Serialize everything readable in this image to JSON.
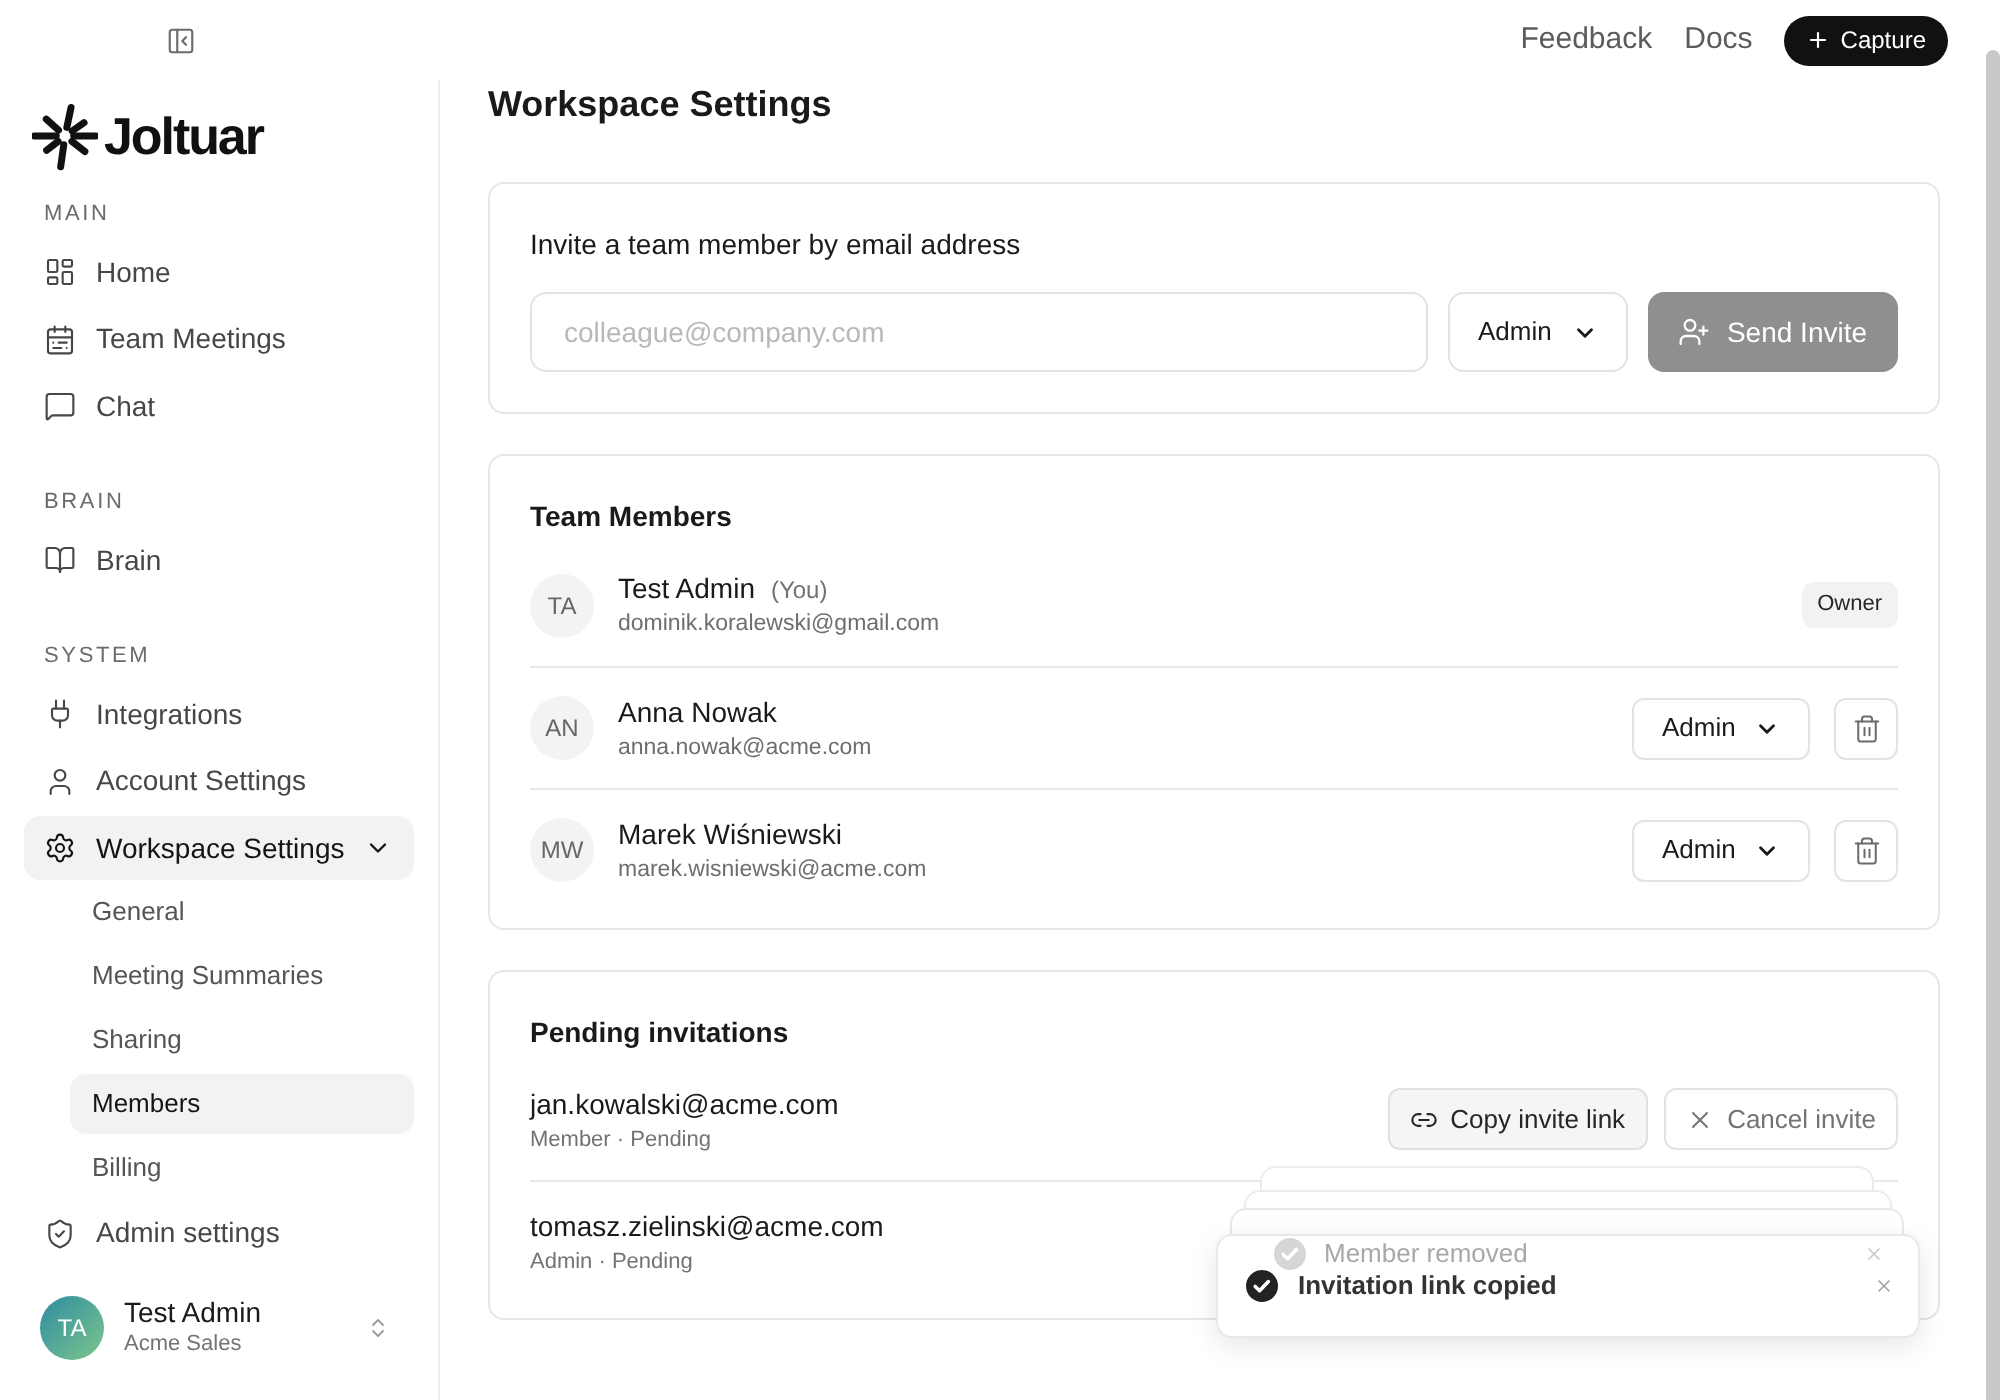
{
  "sidebar": {
    "logo": {
      "wordmark": "Joltuar"
    },
    "sections": [
      {
        "label": "MAIN",
        "items": [
          {
            "label": "Home",
            "selected": false
          },
          {
            "label": "Team Meetings",
            "selected": false
          },
          {
            "label": "Chat",
            "selected": false
          }
        ]
      },
      {
        "label": "BRAIN",
        "items": [
          {
            "label": "Brain",
            "selected": false
          }
        ]
      },
      {
        "label": "SYSTEM",
        "items": [
          {
            "label": "Integrations",
            "selected": false
          },
          {
            "label": "Account Settings",
            "selected": false
          },
          {
            "label": "Workspace Settings",
            "selected": true,
            "expanded": true,
            "children": [
              {
                "label": "General",
                "selected": false
              },
              {
                "label": "Meeting Summaries",
                "selected": false
              },
              {
                "label": "Sharing",
                "selected": false
              },
              {
                "label": "Members",
                "selected": true
              },
              {
                "label": "Billing",
                "selected": false
              }
            ]
          },
          {
            "label": "Admin settings",
            "selected": false
          }
        ]
      }
    ],
    "user": {
      "initials": "TA",
      "name": "Test Admin",
      "workspace": "Acme Sales"
    }
  },
  "top_bar": {
    "links": [
      "Feedback",
      "Docs"
    ],
    "capture_button": "Capture"
  },
  "page": {
    "title": "Workspace Settings"
  },
  "invite": {
    "label": "Invite a team member by email address",
    "email": {
      "placeholder": "colleague@company.com"
    },
    "role": "Admin",
    "button": {
      "label": "Send Invite",
      "disabled": true
    }
  },
  "team_members": {
    "title": "Team Members",
    "members": [
      {
        "initials": "TA",
        "name": "Test Admin",
        "you_tag": "(You)",
        "email": "dominik.koralewski@gmail.com",
        "badge": "Owner"
      },
      {
        "initials": "AN",
        "name": "Anna Nowak",
        "email": "anna.nowak@acme.com",
        "role": "Admin"
      },
      {
        "initials": "MW",
        "name": "Marek Wiśniewski",
        "email": "marek.wisniewski@acme.com",
        "role": "Admin"
      }
    ]
  },
  "pending_invitations": {
    "title": "Pending invitations",
    "invites": [
      {
        "email": "jan.kowalski@acme.com",
        "details": "Member · Pending",
        "actions": [
          {
            "kind": "copy",
            "label": "Copy invite link"
          },
          {
            "kind": "cancel",
            "label": "Cancel invite"
          }
        ]
      },
      {
        "email": "tomasz.zielinski@acme.com",
        "details": "Admin · Pending"
      }
    ]
  },
  "toasts": [
    {
      "message": "Member removed",
      "faded": true
    },
    {
      "message": "Invitation link copied",
      "faded": false
    }
  ]
}
